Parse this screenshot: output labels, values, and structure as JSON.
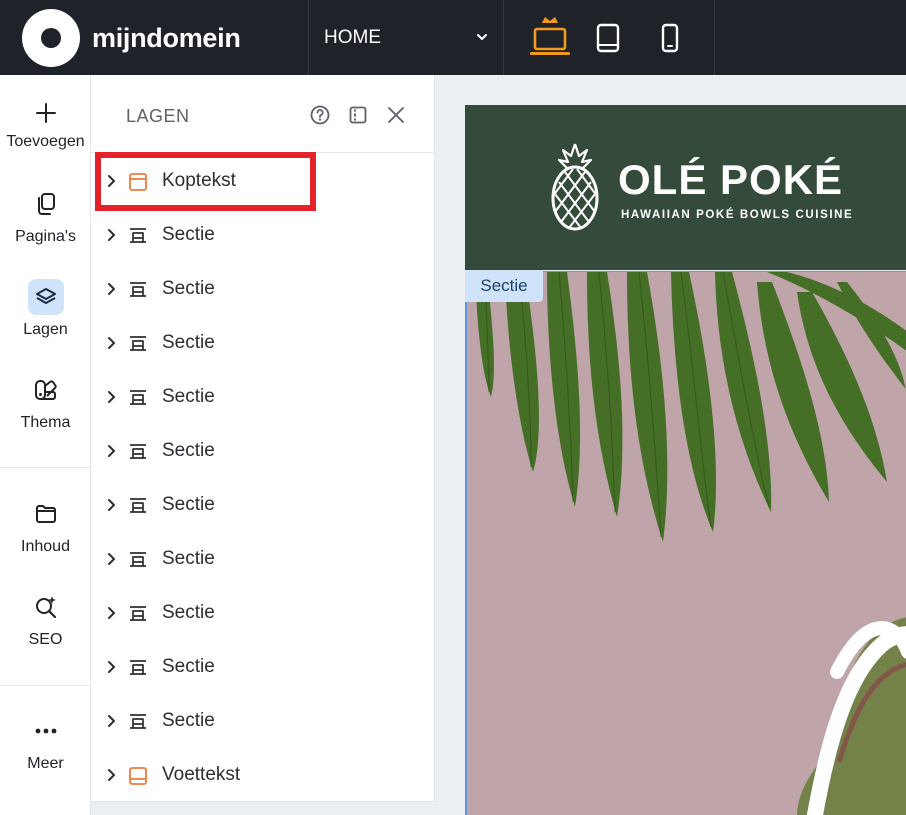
{
  "topbar": {
    "logo_text": "mijndomein",
    "page_selector": "HOME",
    "devices": [
      "laptop-icon",
      "tablet-icon",
      "phone-icon"
    ],
    "active_device": "laptop-icon",
    "accent": "#f29a20"
  },
  "rail": {
    "items": [
      {
        "icon": "plus-icon",
        "label": "Toevoegen"
      },
      {
        "icon": "pages-icon",
        "label": "Pagina's"
      },
      {
        "icon": "layers-icon",
        "label": "Lagen",
        "active": true
      },
      {
        "icon": "theme-icon",
        "label": "Thema"
      },
      {
        "icon": "folder-icon",
        "label": "Inhoud"
      },
      {
        "icon": "seo-icon",
        "label": "SEO"
      },
      {
        "icon": "more-icon",
        "label": "Meer"
      }
    ]
  },
  "panel": {
    "title": "LAGEN",
    "icons": [
      "help-icon",
      "dock-icon",
      "close-icon"
    ],
    "layers": [
      {
        "label": "Koptekst",
        "type": "header"
      },
      {
        "label": "Sectie",
        "type": "section"
      },
      {
        "label": "Sectie",
        "type": "section"
      },
      {
        "label": "Sectie",
        "type": "section"
      },
      {
        "label": "Sectie",
        "type": "section"
      },
      {
        "label": "Sectie",
        "type": "section"
      },
      {
        "label": "Sectie",
        "type": "section"
      },
      {
        "label": "Sectie",
        "type": "section"
      },
      {
        "label": "Sectie",
        "type": "section"
      },
      {
        "label": "Sectie",
        "type": "section"
      },
      {
        "label": "Sectie",
        "type": "section"
      },
      {
        "label": "Voettekst",
        "type": "footer"
      }
    ]
  },
  "canvas": {
    "brand": "OLÉ POKÉ",
    "tagline": "HAWAIIAN POKÉ BOWLS CUISINE",
    "section_tag": "Sectie",
    "header_color": "#344a3b",
    "section_bg": "#bfa4aa"
  }
}
